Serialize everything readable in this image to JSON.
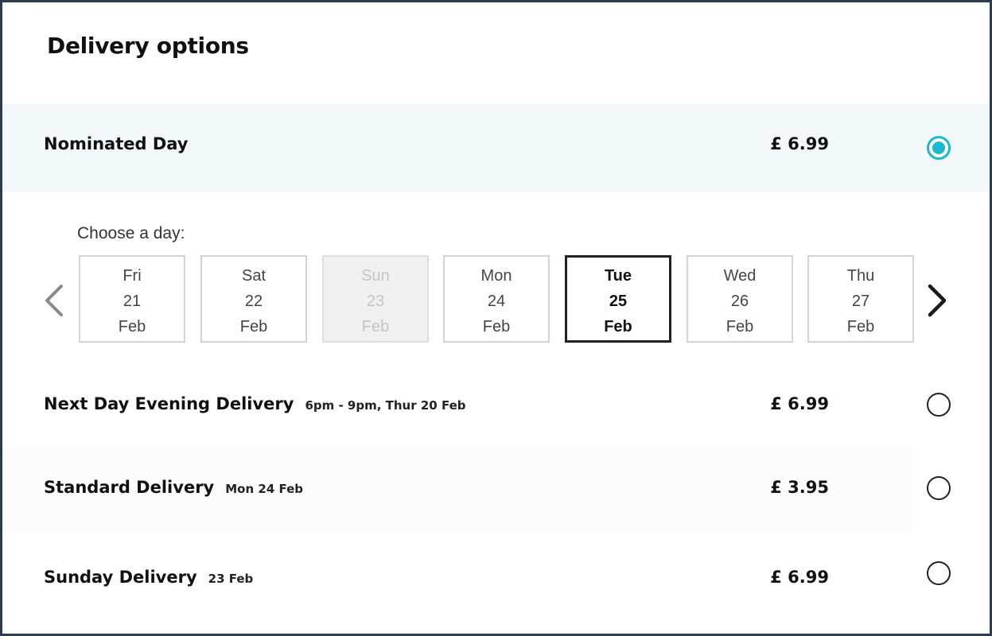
{
  "panel": {
    "title": "Delivery options"
  },
  "options": [
    {
      "name": "Nominated Day",
      "detail": "",
      "price": "£ 6.99",
      "selected": true
    },
    {
      "name": "Next Day Evening Delivery",
      "detail": "6pm - 9pm, Thur 20 Feb",
      "price": "£ 6.99",
      "selected": false
    },
    {
      "name": "Standard Delivery",
      "detail": "Mon 24 Feb",
      "price": "£ 3.95",
      "selected": false
    },
    {
      "name": "Sunday Delivery",
      "detail": "23 Feb",
      "price": "£ 6.99",
      "selected": false
    }
  ],
  "day_picker": {
    "label": "Choose a day:",
    "prev_icon": "chevron-left-icon",
    "next_icon": "chevron-right-icon",
    "days": [
      {
        "day": "Fri",
        "date": "21",
        "month": "Feb",
        "state": "available"
      },
      {
        "day": "Sat",
        "date": "22",
        "month": "Feb",
        "state": "available"
      },
      {
        "day": "Sun",
        "date": "23",
        "month": "Feb",
        "state": "disabled"
      },
      {
        "day": "Mon",
        "date": "24",
        "month": "Feb",
        "state": "available"
      },
      {
        "day": "Tue",
        "date": "25",
        "month": "Feb",
        "state": "selected"
      },
      {
        "day": "Wed",
        "date": "26",
        "month": "Feb",
        "state": "available"
      },
      {
        "day": "Thu",
        "date": "27",
        "month": "Feb",
        "state": "available"
      }
    ]
  },
  "colors": {
    "accent": "#1bb8cf",
    "selected_row_bg": "#f2f7fa",
    "frame_border": "#2f3a4a"
  }
}
